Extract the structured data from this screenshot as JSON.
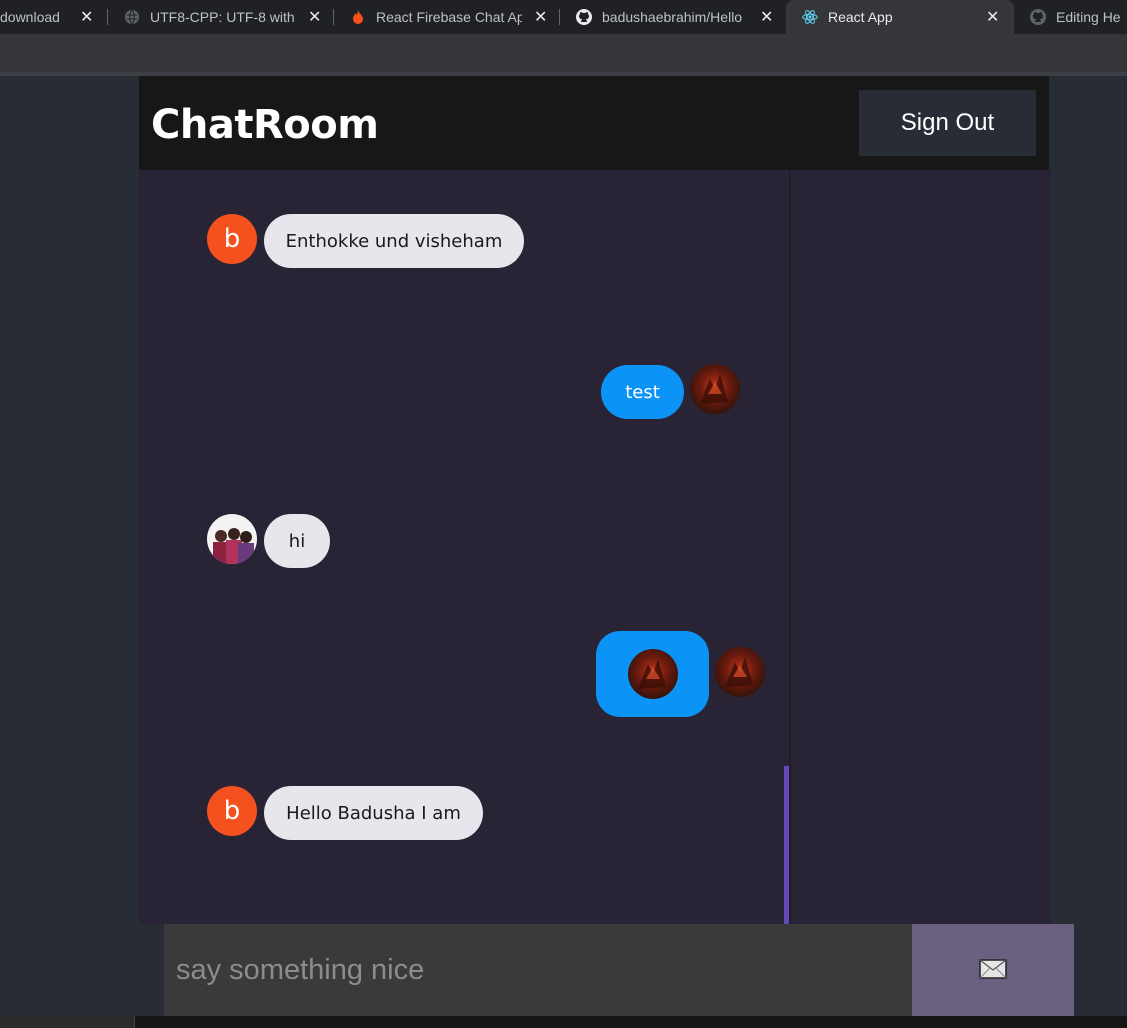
{
  "browser": {
    "tabs": [
      {
        "title": "download"
      },
      {
        "title": "UTF8-CPP: UTF-8 with"
      },
      {
        "title": "React Firebase Chat Ap"
      },
      {
        "title": "badushaebrahim/Hello"
      },
      {
        "title": "React App"
      },
      {
        "title": "Editing He"
      }
    ]
  },
  "header": {
    "brand": "ChatRoom",
    "sign_out": "Sign Out"
  },
  "messages": [
    {
      "text": "Enthokke und visheham",
      "type": "received",
      "avatar": "letter",
      "avatar_letter": "b"
    },
    {
      "text": "test",
      "type": "sent",
      "avatar": "photo"
    },
    {
      "text": "hi",
      "type": "received",
      "avatar": "photo"
    },
    {
      "text": "",
      "type": "sent",
      "avatar": "photo",
      "content": "image"
    },
    {
      "text": "Hello Badusha I am",
      "type": "received",
      "avatar": "letter",
      "avatar_letter": "b"
    }
  ],
  "form": {
    "placeholder": "say something nice",
    "send_icon": "envelope-icon"
  },
  "colors": {
    "sent": "#0b93f6",
    "received": "#e8e6ec",
    "avatar_letter": "#f4511e",
    "send_button": "#6b6080",
    "scrollbar": "#6649b8"
  }
}
